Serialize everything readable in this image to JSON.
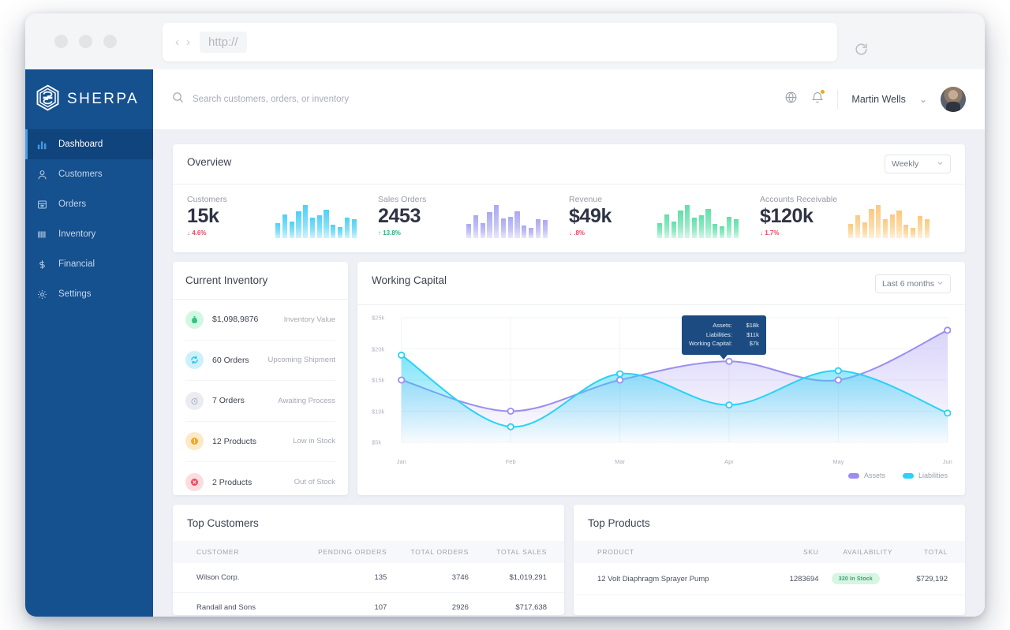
{
  "browser": {
    "url_placeholder": "http://",
    "back_glyph": "‹",
    "forward_glyph": "›"
  },
  "sidebar": {
    "brand": "SHERPA",
    "items": [
      {
        "label": "Dashboard",
        "icon": "bar-chart-icon",
        "active": true
      },
      {
        "label": "Customers",
        "icon": "user-icon",
        "active": false
      },
      {
        "label": "Orders",
        "icon": "list-icon",
        "active": false
      },
      {
        "label": "Inventory",
        "icon": "boxes-icon",
        "active": false
      },
      {
        "label": "Financial",
        "icon": "dollar-icon",
        "active": false
      },
      {
        "label": "Settings",
        "icon": "gear-icon",
        "active": false
      }
    ],
    "bg_color": "#15508f",
    "active_bg_color": "#10447c",
    "accent_color": "#4a9fe8"
  },
  "header": {
    "search_placeholder": "Search customers, orders, or inventory",
    "search_value": "",
    "user_name": "Martin Wells",
    "chevron": "⌄",
    "notification_dot_color": "#f5a623"
  },
  "overview": {
    "title": "Overview",
    "period_selected": "Weekly",
    "kpis": [
      {
        "label": "Customers",
        "value": "15k",
        "delta": "4.6%",
        "direction": "down",
        "arrow": "↓",
        "color": "#4dd0f7"
      },
      {
        "label": "Sales Orders",
        "value": "2453",
        "delta": "13.8%",
        "direction": "up",
        "arrow": "↑",
        "color": "#a9a8f0"
      },
      {
        "label": "Revenue",
        "value": "$49k",
        "delta": ".8%",
        "direction": "down",
        "arrow": "↓",
        "color": "#5fe0a8"
      },
      {
        "label": "Accounts Receivable",
        "value": "$120k",
        "delta": "1.7%",
        "direction": "down",
        "arrow": "↓",
        "color": "#fbc97e"
      }
    ],
    "spark_values": [
      [
        46,
        72,
        50,
        82,
        100,
        62,
        68,
        86,
        40,
        34,
        62,
        58
      ],
      [
        42,
        68,
        46,
        78,
        100,
        60,
        64,
        82,
        38,
        32,
        58,
        54
      ],
      [
        46,
        72,
        50,
        84,
        100,
        62,
        70,
        88,
        42,
        36,
        64,
        58
      ],
      [
        44,
        70,
        48,
        88,
        100,
        58,
        72,
        84,
        40,
        30,
        66,
        56
      ]
    ]
  },
  "inventory": {
    "title": "Current Inventory",
    "rows": [
      {
        "value": "$1,098,9876",
        "meta": "Inventory Value",
        "icon": "money-bag-icon",
        "bg": "#d4f7e4",
        "fg": "#2fc57f"
      },
      {
        "value": "60 Orders",
        "meta": "Upcoming Shipment",
        "icon": "refresh-icon",
        "bg": "#cdf1fb",
        "fg": "#22c4ec"
      },
      {
        "value": "7 Orders",
        "meta": "Awaiting Process",
        "icon": "clock-icon",
        "bg": "#ebecf2",
        "fg": "#a7adbb"
      },
      {
        "value": "12 Products",
        "meta": "Low in Stock",
        "icon": "warning-icon",
        "bg": "#fde9c8",
        "fg": "#f5a623"
      },
      {
        "value": "2 Products",
        "meta": "Out of Stock",
        "icon": "x-circle-icon",
        "bg": "#fcdcdf",
        "fg": "#f0465c"
      }
    ]
  },
  "chart_data": {
    "type": "area",
    "title": "Working Capital",
    "range_selected": "Last 6 months",
    "x": [
      "Jan",
      "Feb",
      "Mar",
      "Apr",
      "May",
      "Jun"
    ],
    "ylabel": "",
    "xlabel": "",
    "yticks": [
      "$25k",
      "$20k",
      "$15k",
      "$10k",
      "$5k"
    ],
    "ylim": [
      5,
      25
    ],
    "grid": true,
    "legend_position": "bottom-right",
    "series": [
      {
        "name": "Assets",
        "color": "#9b8ef0",
        "values": [
          15,
          10,
          15,
          18,
          15,
          23
        ]
      },
      {
        "name": "Liabilities",
        "color": "#2ad2f5",
        "values": [
          19,
          7.5,
          16,
          11,
          16.5,
          9.7
        ]
      }
    ],
    "tooltip": {
      "anchor_x": "Apr",
      "rows": [
        {
          "key": "Assets:",
          "value": "$18k"
        },
        {
          "key": "Liabilities:",
          "value": "$11k"
        },
        {
          "key": "Working Capital:",
          "value": "$7k"
        }
      ]
    }
  },
  "top_customers": {
    "title": "Top Customers",
    "columns": [
      "CUSTOMER",
      "PENDING ORDERS",
      "TOTAL ORDERS",
      "TOTAL SALES"
    ],
    "rows": [
      [
        "Wilson Corp.",
        "135",
        "3746",
        "$1,019,291"
      ],
      [
        "Randall and Sons",
        "107",
        "2926",
        "$717,638"
      ]
    ]
  },
  "top_products": {
    "title": "Top Products",
    "columns": [
      "PRODUCT",
      "SKU",
      "AVAILABILITY",
      "TOTAL"
    ],
    "rows": [
      {
        "product": "12 Volt Diaphragm Sprayer Pump",
        "sku": "1283694",
        "availability": "320 In Stock",
        "total": "$729,192"
      }
    ]
  }
}
